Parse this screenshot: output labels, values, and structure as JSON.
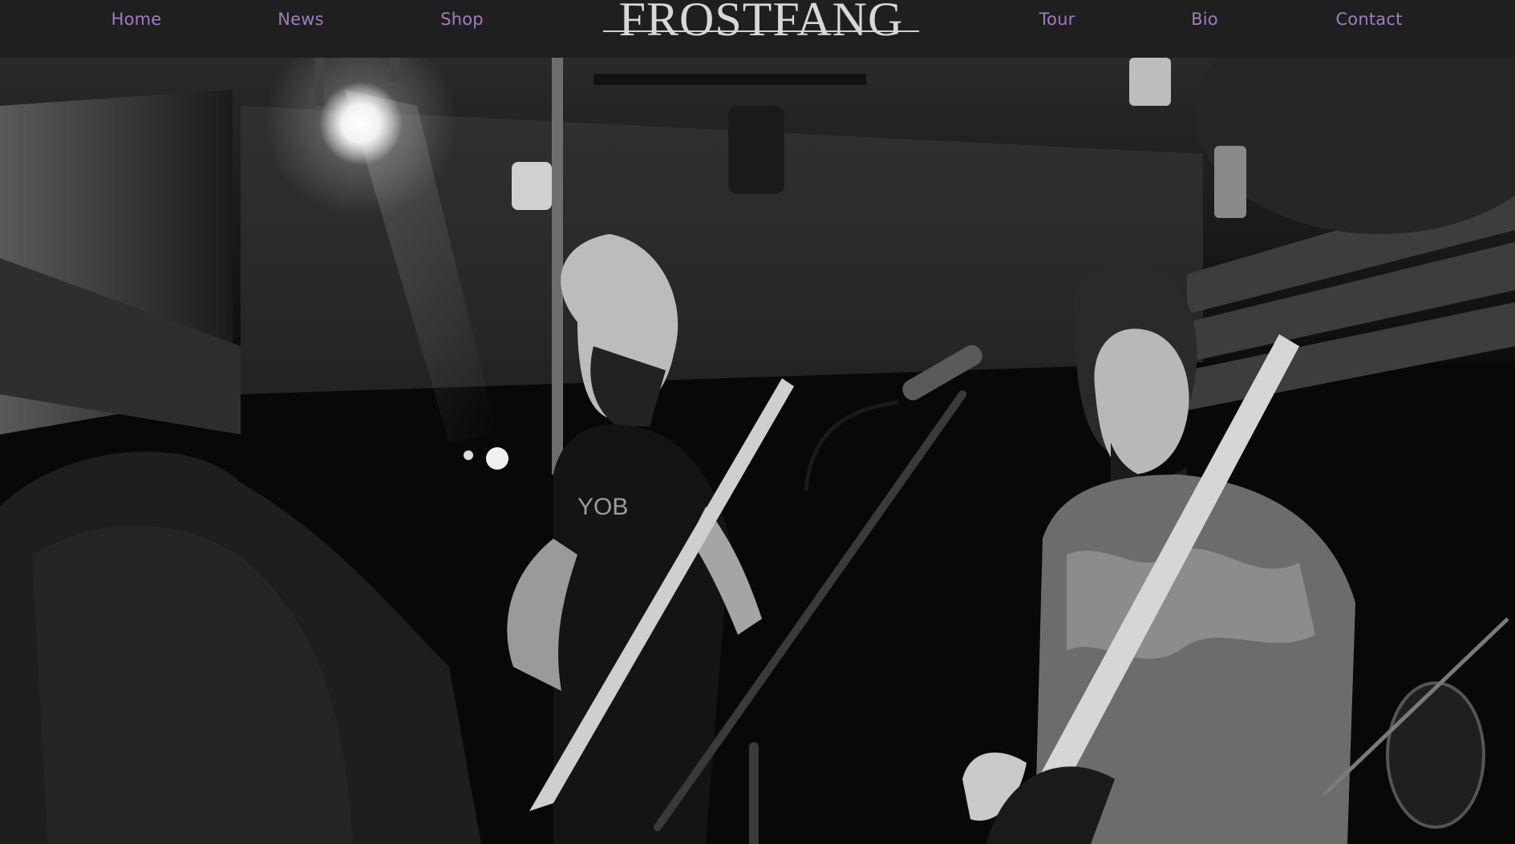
{
  "nav": {
    "left_items": [
      "Home",
      "News",
      "Shop"
    ],
    "right_items": [
      "Tour",
      "Bio",
      "Contact"
    ],
    "logo_text": "FROSTFANG",
    "link_color": "#a07cc0",
    "bar_color": "#1f1f1f"
  },
  "hero": {
    "description_icon": "concert-photo",
    "tone": "black-and-white"
  }
}
